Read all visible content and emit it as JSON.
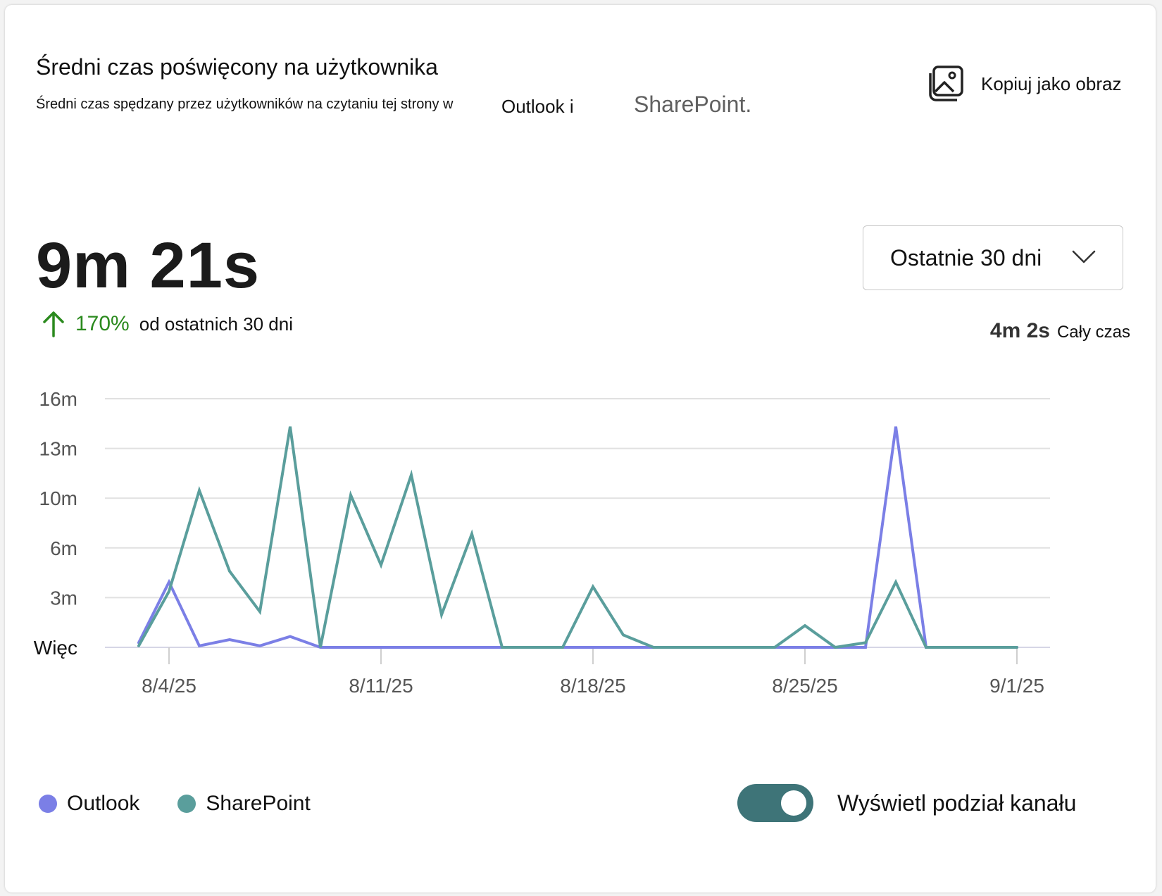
{
  "header": {
    "title": "Średni czas poświęcony na użytkownika",
    "subtitle": "Średni czas spędzany przez użytkowników na czytaniu tej strony w",
    "subtitle_outlook": "Outlook i",
    "subtitle_sharepoint": "SharePoint.",
    "copy_label": "Kopiuj jako obraz"
  },
  "summary": {
    "value": "9m 21s",
    "change_pct": "170%",
    "change_text": "od ostatnich 30 dni",
    "alltime_value": "4m 2s",
    "alltime_label": "Cały czas"
  },
  "filter": {
    "selected": "Ostatnie 30 dni"
  },
  "legend": {
    "outlook": "Outlook",
    "sharepoint": "SharePoint"
  },
  "toggle": {
    "label": "Wyświetl podział kanału",
    "on": true
  },
  "colors": {
    "outlook": "#7b7fe6",
    "sharepoint": "#5a9e9c",
    "increase": "#2b8a1e",
    "toggle": "#3e7478",
    "grid": "#e1e1e1"
  },
  "chart_data": {
    "type": "line",
    "ylim": [
      0,
      16
    ],
    "y_ticks": [
      {
        "value": 0,
        "label": "Więc"
      },
      {
        "value": 3.2,
        "label": "3m"
      },
      {
        "value": 6.4,
        "label": "6m"
      },
      {
        "value": 9.6,
        "label": "10m"
      },
      {
        "value": 12.8,
        "label": "13m"
      },
      {
        "value": 16,
        "label": "16m"
      }
    ],
    "x_ticks": [
      {
        "index": 1,
        "label": "8/4/25"
      },
      {
        "index": 8,
        "label": "8/11/25"
      },
      {
        "index": 15,
        "label": "8/18/25"
      },
      {
        "index": 22,
        "label": "8/25/25"
      },
      {
        "index": 29,
        "label": "9/1/25"
      }
    ],
    "x_count": 30,
    "series": [
      {
        "name": "Outlook",
        "color": "#7b7fe6",
        "values": [
          0.3,
          4.2,
          0.1,
          0.5,
          0.1,
          0.7,
          0,
          0,
          0,
          0,
          0,
          0,
          0,
          0,
          0,
          0,
          0,
          0,
          0,
          0,
          0,
          0,
          0,
          0,
          0,
          14.2,
          0,
          0,
          0,
          0
        ]
      },
      {
        "name": "SharePoint",
        "color": "#5a9e9c",
        "values": [
          0.1,
          3.6,
          10.1,
          4.9,
          2.3,
          14.2,
          0,
          9.8,
          5.3,
          11.1,
          2.1,
          7.3,
          0,
          0,
          0,
          3.9,
          0.8,
          0,
          0,
          0,
          0,
          0,
          1.4,
          0,
          0.3,
          4.2,
          0,
          0,
          0,
          0
        ]
      }
    ]
  }
}
